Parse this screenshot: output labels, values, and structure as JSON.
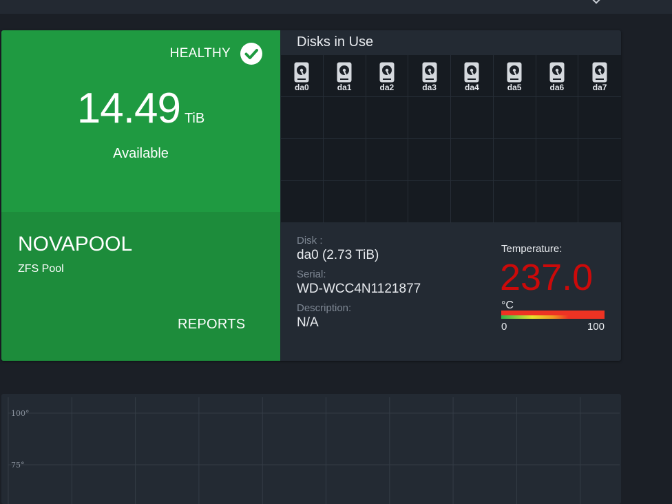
{
  "pool": {
    "status": "HEALTHY",
    "available_value": "14.49",
    "available_unit": "TiB",
    "available_label": "Available",
    "name": "NOVAPOOL",
    "type": "ZFS Pool",
    "reports_label": "REPORTS"
  },
  "disks": {
    "title": "Disks in Use",
    "items": [
      {
        "label": "da0"
      },
      {
        "label": "da1"
      },
      {
        "label": "da2"
      },
      {
        "label": "da3"
      },
      {
        "label": "da4"
      },
      {
        "label": "da5"
      },
      {
        "label": "da6"
      },
      {
        "label": "da7"
      }
    ],
    "icon": "hard-drive-icon"
  },
  "disk_detail": {
    "disk_key": "Disk :",
    "disk_value": "da0 (2.73 TiB)",
    "serial_key": "Serial:",
    "serial_value": "WD-WCC4N1121877",
    "description_key": "Description:",
    "description_value": "N/A",
    "temperature_label": "Temperature:",
    "temperature_value": "237.0",
    "temperature_unit": "°C",
    "gauge_min": "0",
    "gauge_max": "100",
    "temperature_color": "#cc0a0a"
  },
  "chart_data": {
    "type": "line",
    "y_tick_labels": [
      "100°",
      "75°"
    ],
    "grid": true,
    "series": []
  },
  "colors": {
    "healthy_green": "#1f9a41",
    "background": "#1b1f26",
    "panel": "#232a33"
  }
}
